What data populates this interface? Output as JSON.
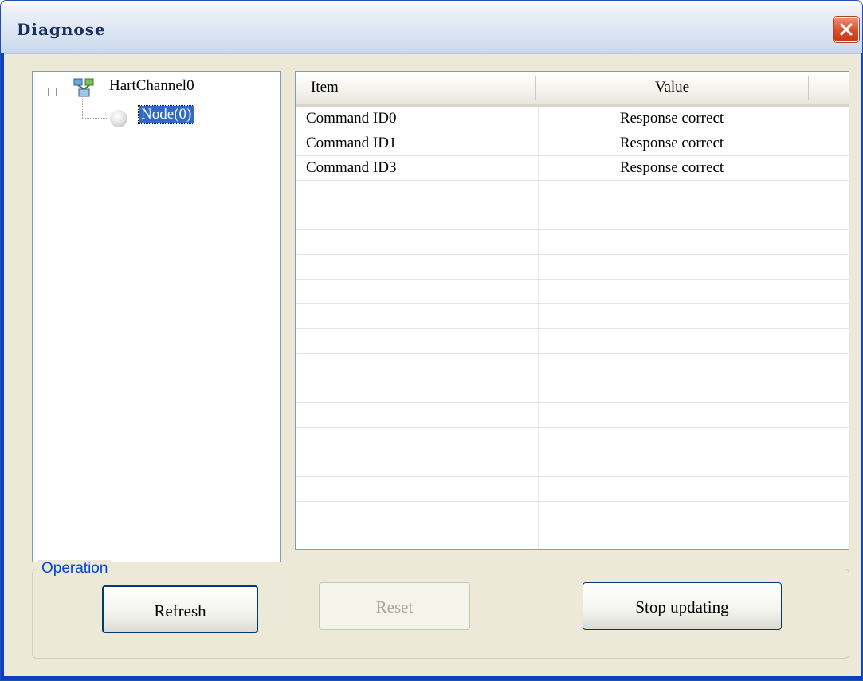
{
  "window": {
    "title": "Diagnose"
  },
  "tree": {
    "root_label": "HartChannel0",
    "child_label": "Node(0)"
  },
  "grid": {
    "columns": [
      "Item",
      "Value"
    ],
    "rows": [
      {
        "item": "Command ID0",
        "value": "Response correct"
      },
      {
        "item": "Command ID1",
        "value": "Response correct"
      },
      {
        "item": "Command ID3",
        "value": "Response correct"
      },
      {
        "item": "",
        "value": ""
      },
      {
        "item": "",
        "value": ""
      },
      {
        "item": "",
        "value": ""
      },
      {
        "item": "",
        "value": ""
      },
      {
        "item": "",
        "value": ""
      },
      {
        "item": "",
        "value": ""
      },
      {
        "item": "",
        "value": ""
      },
      {
        "item": "",
        "value": ""
      },
      {
        "item": "",
        "value": ""
      },
      {
        "item": "",
        "value": ""
      },
      {
        "item": "",
        "value": ""
      },
      {
        "item": "",
        "value": ""
      },
      {
        "item": "",
        "value": ""
      },
      {
        "item": "",
        "value": ""
      },
      {
        "item": "",
        "value": ""
      }
    ]
  },
  "operation": {
    "group_label": "Operation",
    "refresh_label": "Refresh",
    "reset_label": "Reset",
    "stop_label": "Stop updating"
  },
  "colors": {
    "selection": "#316ac5",
    "group_label": "#0046d5",
    "window_border": "#0a3fc0"
  }
}
